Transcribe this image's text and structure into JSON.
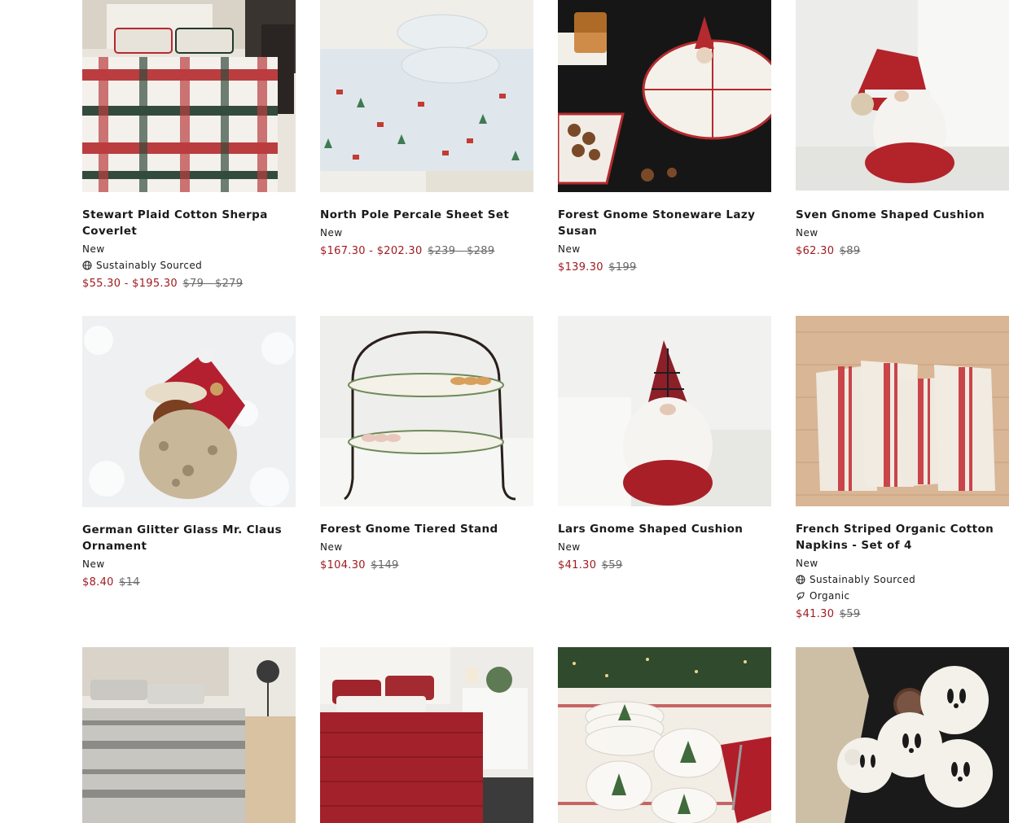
{
  "products": [
    {
      "title": "Stewart Plaid Cotton Sherpa Coverlet",
      "flag": "New",
      "attrs": [
        "Sustainably Sourced"
      ],
      "sale": "$55.30 - $195.30",
      "orig": "$79 - $279"
    },
    {
      "title": "North Pole Percale Sheet Set",
      "flag": "New",
      "attrs": [],
      "sale": "$167.30 - $202.30",
      "orig": "$239 - $289"
    },
    {
      "title": "Forest Gnome Stoneware Lazy Susan",
      "flag": "New",
      "attrs": [],
      "sale": "$139.30",
      "orig": "$199"
    },
    {
      "title": "Sven Gnome Shaped Cushion",
      "flag": "New",
      "attrs": [],
      "sale": "$62.30",
      "orig": "$89"
    },
    {
      "title": "German Glitter Glass Mr. Claus Ornament",
      "flag": "New",
      "attrs": [],
      "sale": "$8.40",
      "orig": "$14"
    },
    {
      "title": "Forest Gnome Tiered Stand",
      "flag": "New",
      "attrs": [],
      "sale": "$104.30",
      "orig": "$149"
    },
    {
      "title": "Lars Gnome Shaped Cushion",
      "flag": "New",
      "attrs": [],
      "sale": "$41.30",
      "orig": "$59"
    },
    {
      "title": "French Striped Organic Cotton Napkins - Set of 4",
      "flag": "New",
      "attrs": [
        "Sustainably Sourced",
        "Organic"
      ],
      "sale": "$41.30",
      "orig": "$59"
    }
  ],
  "icons": {
    "sustainably_sourced": "globe-icon",
    "organic": "leaf-icon"
  },
  "colors": {
    "sale_price": "#a01a1f",
    "original_price": "#6a6a6a",
    "text": "#1a1a1a"
  }
}
